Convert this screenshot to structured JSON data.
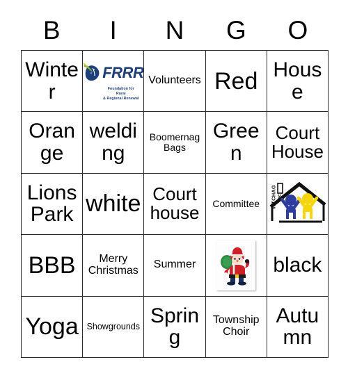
{
  "header": {
    "letters": [
      "B",
      "I",
      "N",
      "G",
      "O"
    ]
  },
  "grid": {
    "rows": [
      [
        {
          "type": "text",
          "label": "Winter",
          "size": "lg"
        },
        {
          "type": "image",
          "label": "FRRR logo",
          "image": "frrr-logo",
          "word": "FRRR",
          "tagline_line1": "Foundation for Rural",
          "tagline_line2": "& Regional Renewal"
        },
        {
          "type": "text",
          "label": "Volunteers",
          "size": "sm"
        },
        {
          "type": "text",
          "label": "Red",
          "size": "xl"
        },
        {
          "type": "text",
          "label": "House",
          "size": "lg"
        }
      ],
      [
        {
          "type": "text",
          "label": "Orange",
          "size": "lg"
        },
        {
          "type": "text",
          "label": "welding",
          "size": "lg"
        },
        {
          "type": "text",
          "label": "Boomernag Bags",
          "size": "xs"
        },
        {
          "type": "text",
          "label": "Green",
          "size": "lg"
        },
        {
          "type": "text",
          "label": "Court House",
          "size": "md"
        }
      ],
      [
        {
          "type": "text",
          "label": "Lions Park",
          "size": "lg"
        },
        {
          "type": "text",
          "label": "white",
          "size": "xl"
        },
        {
          "type": "text",
          "label": "Court house",
          "size": "md"
        },
        {
          "type": "text",
          "label": "Committee",
          "size": "xs"
        },
        {
          "type": "image",
          "label": "WTCHAG Inc. logo",
          "image": "wtchag-logo",
          "text": "WTCHAG Inc."
        }
      ],
      [
        {
          "type": "text",
          "label": "BBB",
          "size": "xl"
        },
        {
          "type": "text",
          "label": "Merry Christmas",
          "size": "sm"
        },
        {
          "type": "text",
          "label": "Summer",
          "size": "sm"
        },
        {
          "type": "image",
          "label": "Santa Claus",
          "image": "santa-icon"
        },
        {
          "type": "text",
          "label": "black",
          "size": "lg"
        }
      ],
      [
        {
          "type": "text",
          "label": "Yoga",
          "size": "xl"
        },
        {
          "type": "text",
          "label": "Showgrounds",
          "size": "xxs"
        },
        {
          "type": "text",
          "label": "Spring",
          "size": "lg"
        },
        {
          "type": "text",
          "label": "Township Choir",
          "size": "sm"
        },
        {
          "type": "text",
          "label": "Autumn",
          "size": "lg"
        }
      ]
    ]
  },
  "colors": {
    "grid_line": "#2b2b2b",
    "text": "#000000",
    "background": "#ffffff",
    "frrr_navy": "#1f3f7a",
    "frrr_green": "#5aa03c",
    "frrr_yellow": "#e8c92b",
    "wtchag_blue": "#2d3c9e",
    "wtchag_yellow": "#f5d60a",
    "santa_red": "#cf2027",
    "santa_green": "#2f8a46"
  }
}
